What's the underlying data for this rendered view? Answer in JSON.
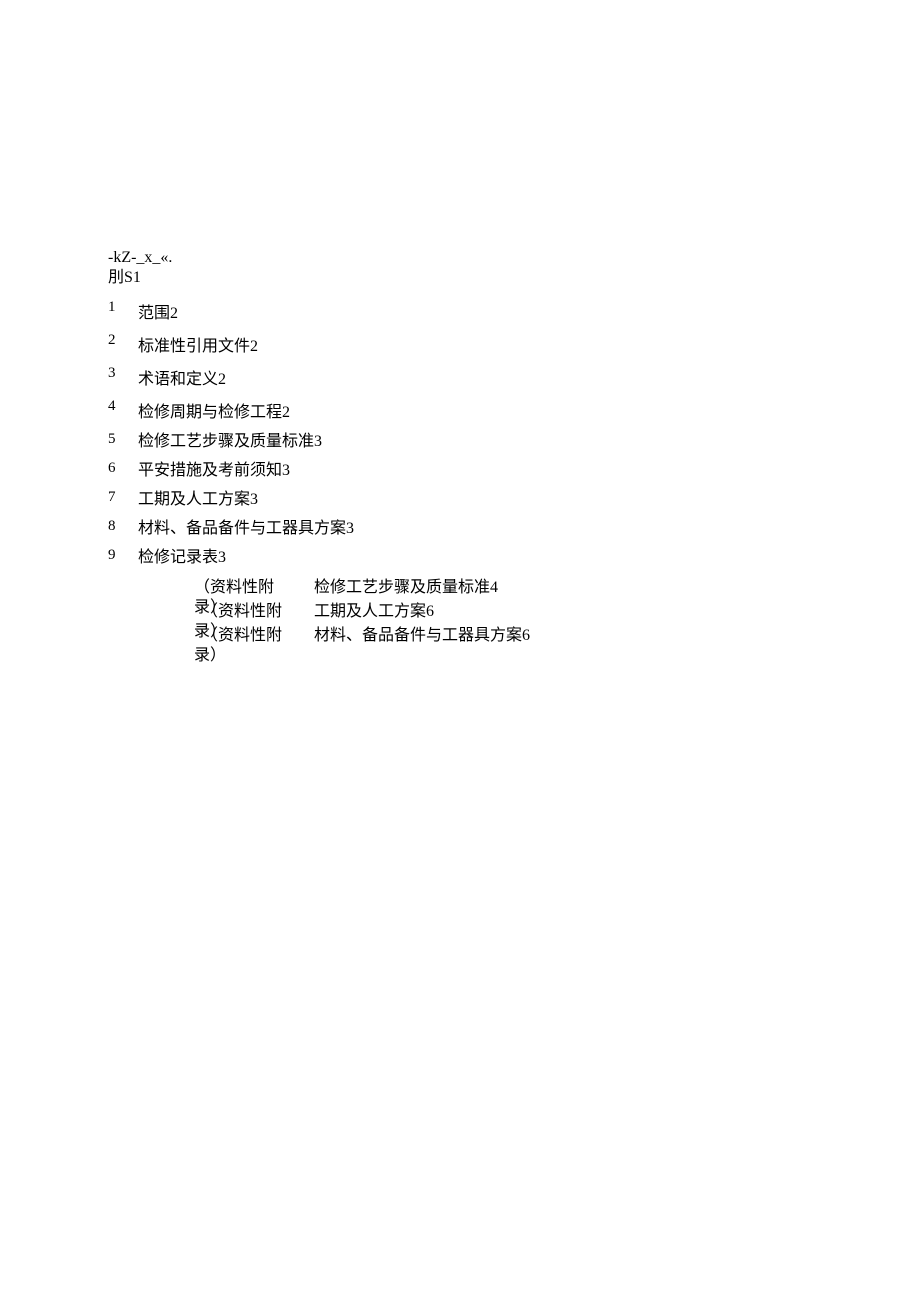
{
  "header": {
    "line1": "-kZ-_x_«.",
    "line2": "刖S1"
  },
  "toc": [
    {
      "num": "1",
      "text": "范围2"
    },
    {
      "num": "2",
      "text": "标准性引用文件2"
    },
    {
      "num": "3",
      "text": "术语和定义2"
    },
    {
      "num": "4",
      "text": "检修周期与检修工程2"
    },
    {
      "num": "5",
      "text": "检修工艺步骤及质量标准3"
    },
    {
      "num": "6",
      "text": "平安措施及考前须知3"
    },
    {
      "num": "7",
      "text": "工期及人工方案3"
    },
    {
      "num": "8",
      "text": "材料、备品备件与工器具方案3"
    },
    {
      "num": "9",
      "text": "检修记录表3"
    }
  ],
  "appendix": [
    {
      "label": "（资料性附录）",
      "text": "检修工艺步骤及质量标准4"
    },
    {
      "label": "（资料性附录）",
      "text": "工期及人工方案6"
    },
    {
      "label": "（资料性附录）",
      "text": "材料、备品备件与工器具方案6"
    }
  ]
}
